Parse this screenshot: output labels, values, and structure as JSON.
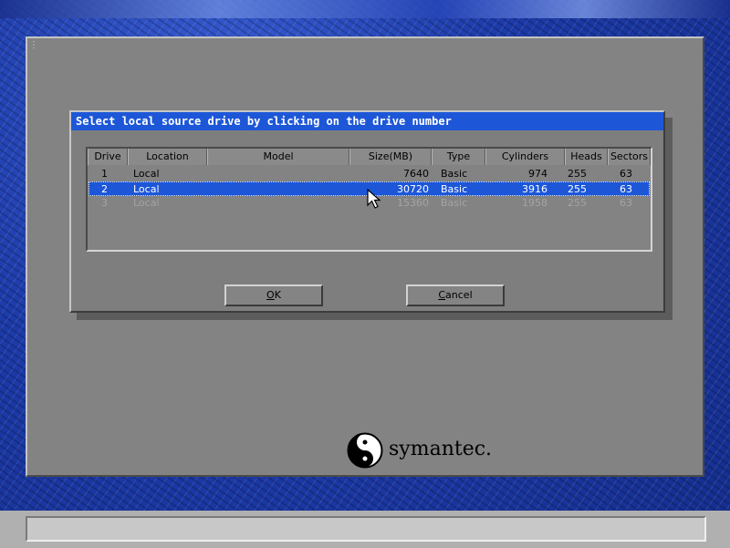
{
  "dialog": {
    "title": "Select local source drive by clicking on the drive number"
  },
  "table": {
    "columns": [
      "Drive",
      "Location",
      "Model",
      "Size(MB)",
      "Type",
      "Cylinders",
      "Heads",
      "Sectors"
    ],
    "rows": [
      {
        "drive": "1",
        "location": "Local",
        "model": "",
        "size": "7640",
        "type": "Basic",
        "cylinders": "974",
        "heads": "255",
        "sectors": "63",
        "state": "normal"
      },
      {
        "drive": "2",
        "location": "Local",
        "model": "",
        "size": "30720",
        "type": "Basic",
        "cylinders": "3916",
        "heads": "255",
        "sectors": "63",
        "state": "selected"
      },
      {
        "drive": "3",
        "location": "Local",
        "model": "",
        "size": "15360",
        "type": "Basic",
        "cylinders": "1958",
        "heads": "255",
        "sectors": "63",
        "state": "disabled"
      }
    ]
  },
  "buttons": {
    "ok_key": "O",
    "ok_rest": "K",
    "cancel_key": "C",
    "cancel_rest": "ancel"
  },
  "branding": {
    "logo_text": "symantec."
  },
  "icons": {
    "cursor": "mouse-pointer-icon",
    "logo": "symantec-logo-icon"
  },
  "colors": {
    "titlebar": "#1d57d8",
    "selection": "#1d57d8",
    "panel": "#838383",
    "desktop": "#1f3fae"
  }
}
